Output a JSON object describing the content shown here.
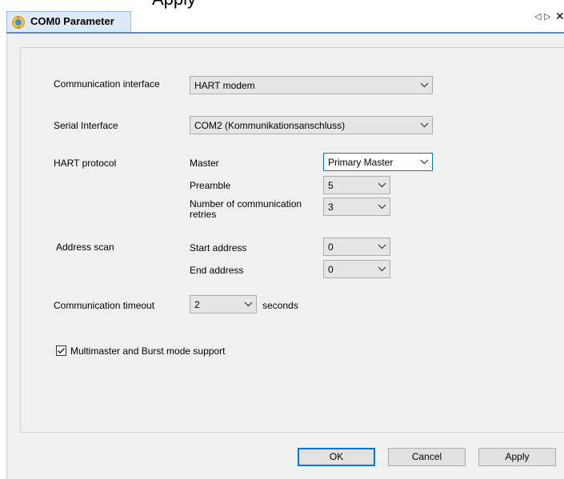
{
  "topbar": {
    "clipped_text": "⌐   ..  ɑ  ▫  ▸  ▭ˉ  ▫  ▪  Apply"
  },
  "tab": {
    "title": "COM0 Parameter"
  },
  "nav": {
    "left_arrow": "◁",
    "right_arrow": "▷",
    "close": "✕"
  },
  "form": {
    "communication_interface": {
      "label": "Communication interface",
      "value": "HART modem"
    },
    "serial_interface": {
      "label": "Serial Interface",
      "value": "COM2 (Kommunikationsanschluss)"
    },
    "hart_protocol": {
      "label": "HART protocol",
      "master": {
        "label": "Master",
        "value": "Primary Master"
      },
      "preamble": {
        "label": "Preamble",
        "value": "5"
      },
      "retries": {
        "label_line1": "Number of communication",
        "label_line2": "retries",
        "value": "3"
      }
    },
    "address_scan": {
      "label": "Address scan",
      "start": {
        "label": "Start address",
        "value": "0"
      },
      "end": {
        "label": "End address",
        "value": "0"
      }
    },
    "timeout": {
      "label": "Communication timeout",
      "value": "2",
      "unit": "seconds"
    },
    "multimaster": {
      "label": "Multimaster and Burst mode support",
      "checked": true
    }
  },
  "buttons": {
    "ok": "OK",
    "cancel": "Cancel",
    "apply": "Apply"
  }
}
